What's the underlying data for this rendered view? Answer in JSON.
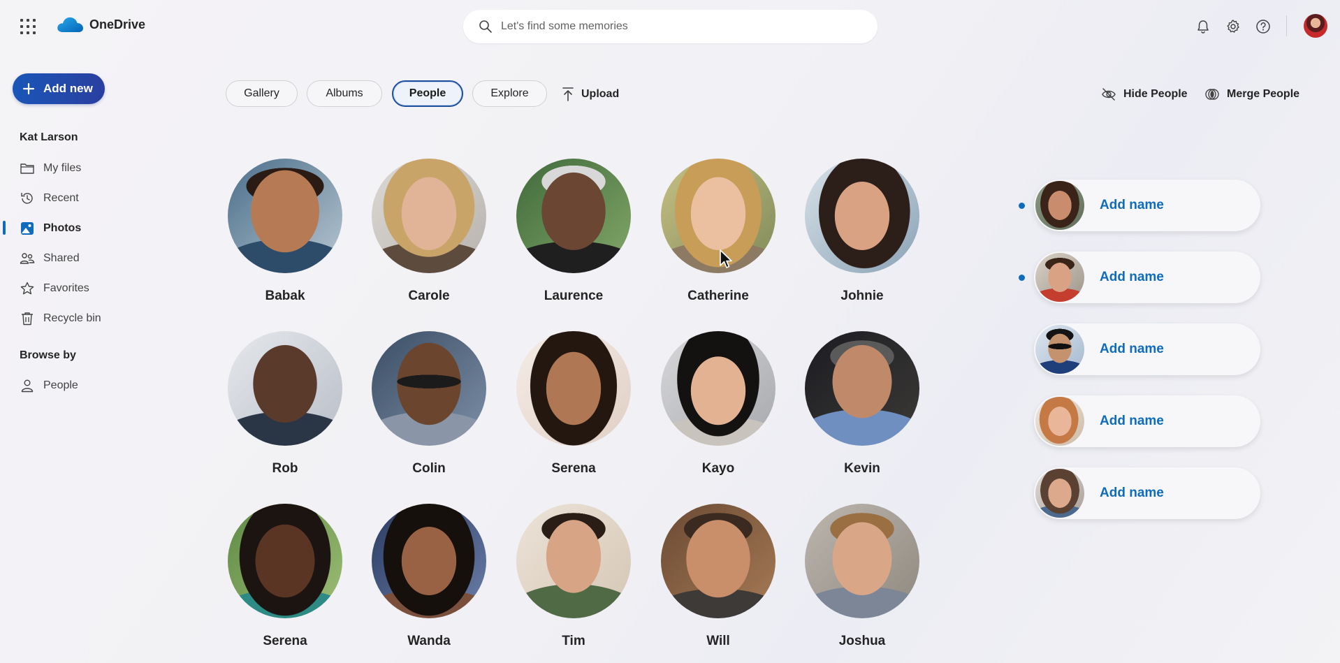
{
  "app": {
    "name": "OneDrive"
  },
  "search": {
    "placeholder": "Let's find some memories"
  },
  "header": {
    "icons": [
      "bell-icon",
      "gear-icon",
      "help-icon"
    ]
  },
  "sidebar": {
    "add_new_label": "Add new",
    "user_name": "Kat Larson",
    "items": [
      {
        "label": "My files",
        "icon": "folder-icon"
      },
      {
        "label": "Recent",
        "icon": "history-icon"
      },
      {
        "label": "Photos",
        "icon": "photo-icon",
        "active": true
      },
      {
        "label": "Shared",
        "icon": "people-icon"
      },
      {
        "label": "Favorites",
        "icon": "star-icon"
      },
      {
        "label": "Recycle bin",
        "icon": "trash-icon"
      }
    ],
    "browse_heading": "Browse by",
    "browse_items": [
      {
        "label": "People",
        "icon": "person-icon"
      }
    ]
  },
  "tabs": [
    {
      "label": "Gallery"
    },
    {
      "label": "Albums"
    },
    {
      "label": "People",
      "active": true
    },
    {
      "label": "Explore"
    }
  ],
  "upload_label": "Upload",
  "actions": {
    "hide_people": "Hide People",
    "merge_people": "Merge People"
  },
  "people": [
    {
      "name": "Babak"
    },
    {
      "name": "Carole"
    },
    {
      "name": "Laurence"
    },
    {
      "name": "Catherine"
    },
    {
      "name": "Johnie"
    },
    {
      "name": "Rob"
    },
    {
      "name": "Colin"
    },
    {
      "name": "Serena"
    },
    {
      "name": "Kayo"
    },
    {
      "name": "Kevin"
    },
    {
      "name": "Serena"
    },
    {
      "name": "Wanda"
    },
    {
      "name": "Tim"
    },
    {
      "name": "Will"
    },
    {
      "name": "Joshua"
    }
  ],
  "suggestions": [
    {
      "label": "Add name",
      "unread": true
    },
    {
      "label": "Add name",
      "unread": true
    },
    {
      "label": "Add name",
      "unread": false
    },
    {
      "label": "Add name",
      "unread": false
    },
    {
      "label": "Add name",
      "unread": false
    }
  ],
  "colors": {
    "accent": "#0f6cbd",
    "add_new_button": "#1a56b8"
  }
}
